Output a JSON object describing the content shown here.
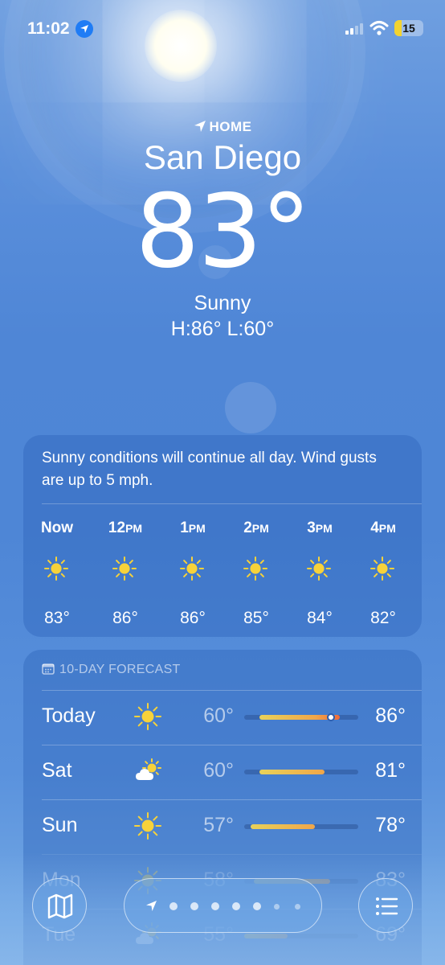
{
  "status_bar": {
    "time": "11:02",
    "battery": "15",
    "icons": [
      "location-arrow-icon",
      "cellular-signal-icon",
      "wifi-icon",
      "battery-icon"
    ]
  },
  "header": {
    "location_label": "HOME",
    "city": "San Diego",
    "temperature": "83°",
    "condition": "Sunny",
    "high_low": "H:86°  L:60°"
  },
  "hourly": {
    "summary": "Sunny conditions will continue all day. Wind gusts are up to 5 mph.",
    "hours": [
      {
        "label": "Now",
        "suffix": "",
        "icon": "sun-icon",
        "temp": "83°"
      },
      {
        "label": "12",
        "suffix": "PM",
        "icon": "sun-icon",
        "temp": "86°"
      },
      {
        "label": "1",
        "suffix": "PM",
        "icon": "sun-icon",
        "temp": "86°"
      },
      {
        "label": "2",
        "suffix": "PM",
        "icon": "sun-icon",
        "temp": "85°"
      },
      {
        "label": "3",
        "suffix": "PM",
        "icon": "sun-icon",
        "temp": "84°"
      },
      {
        "label": "4",
        "suffix": "PM",
        "icon": "sun-icon",
        "temp": "82°"
      }
    ]
  },
  "daily": {
    "title": "10-DAY FORECAST",
    "range_min": 55,
    "range_max": 92,
    "days": [
      {
        "day": "Today",
        "icon": "sun-icon",
        "low": "60°",
        "high": "86°",
        "low_val": 60,
        "high_val": 86,
        "current": 83
      },
      {
        "day": "Sat",
        "icon": "partly-cloudy-icon",
        "low": "60°",
        "high": "81°",
        "low_val": 60,
        "high_val": 81
      },
      {
        "day": "Sun",
        "icon": "sun-icon",
        "low": "57°",
        "high": "78°",
        "low_val": 57,
        "high_val": 78
      },
      {
        "day": "Mon",
        "icon": "sun-icon",
        "low": "58°",
        "high": "83°",
        "low_val": 58,
        "high_val": 83
      },
      {
        "day": "Tue",
        "icon": "partly-cloudy-icon",
        "low": "55°",
        "high": "69°",
        "low_val": 55,
        "high_val": 69
      }
    ]
  },
  "bottom_bar": {
    "map_icon": "map-icon",
    "list_icon": "list-icon",
    "page_dots": 7
  },
  "colors": {
    "location_pill": "#1f7cf5",
    "battery_fill": "#f3d330",
    "sun": "#f7d23a",
    "bar_warm": "#f0a64a",
    "bar_cool": "#e8d25a"
  }
}
